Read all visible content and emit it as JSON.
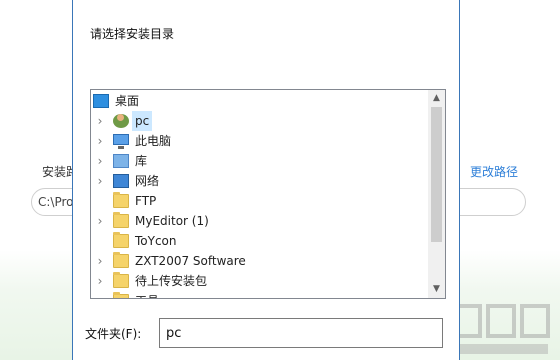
{
  "background": {
    "install_label": "安装路",
    "path_value": "C:\\Pro",
    "change_path_link": "更改路径"
  },
  "dialog": {
    "title": "请选择安装目录",
    "tree": {
      "items": [
        {
          "label": "桌面",
          "icon": "desktop-icon",
          "expandable": false,
          "level": 0
        },
        {
          "label": "pc",
          "icon": "user-folder-icon",
          "expandable": true,
          "level": 1,
          "selected": true
        },
        {
          "label": "此电脑",
          "icon": "computer-icon",
          "expandable": true,
          "level": 1
        },
        {
          "label": "库",
          "icon": "library-icon",
          "expandable": true,
          "level": 1
        },
        {
          "label": "网络",
          "icon": "network-icon",
          "expandable": true,
          "level": 1
        },
        {
          "label": "FTP",
          "icon": "folder-icon",
          "expandable": false,
          "level": 1
        },
        {
          "label": "MyEditor (1)",
          "icon": "folder-icon",
          "expandable": true,
          "level": 1
        },
        {
          "label": "ToYcon",
          "icon": "folder-icon",
          "expandable": false,
          "level": 1
        },
        {
          "label": "ZXT2007 Software",
          "icon": "folder-icon",
          "expandable": true,
          "level": 1
        },
        {
          "label": "待上传安装包",
          "icon": "folder-icon",
          "expandable": true,
          "level": 1
        },
        {
          "label": "工具",
          "icon": "folder-icon",
          "expandable": true,
          "level": 1
        }
      ]
    },
    "folder_label": "文件夹(F):",
    "folder_value": "pc"
  }
}
